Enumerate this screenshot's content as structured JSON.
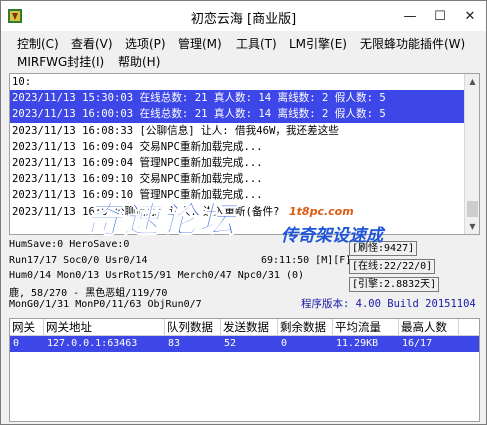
{
  "window": {
    "title": "初恋云海 [商业版]",
    "minimize_glyph": "—",
    "maximize_glyph": "☐",
    "close_glyph": "✕"
  },
  "menu": {
    "items": [
      {
        "label": "控制(C)"
      },
      {
        "label": "查看(V)"
      },
      {
        "label": "选项(P)"
      },
      {
        "label": "管理(M)"
      },
      {
        "label": "工具(T)"
      },
      {
        "label": "LM引擎(E)"
      },
      {
        "label": "无限蜂功能插件(W)"
      },
      {
        "label": "MIRFWG封挂(I)"
      },
      {
        "label": "帮助(H)"
      }
    ]
  },
  "log": {
    "lines": [
      {
        "text": "10:"
      },
      {
        "text": "2023/11/13 15:30:03 在线总数: 21 真人数: 14 离线数: 2 假人数: 5"
      },
      {
        "text": "2023/11/13 16:00:03 在线总数: 21 真人数: 14 离线数: 2 假人数: 5"
      },
      {
        "text": "2023/11/13 16:08:33 [公聊信息] 让人: 借我46W，我还差这些"
      },
      {
        "text": "2023/11/13 16:09:04 交易NPC重新加载完成..."
      },
      {
        "text": "2023/11/13 16:09:04 管理NPC重新加载完成..."
      },
      {
        "text": "2023/11/13 16:09:10 交易NPC重新加载完成..."
      },
      {
        "text": "2023/11/13 16:09:10 管理NPC重新加载完成..."
      },
      {
        "text": "2023/11/13 16:0   公聊信息] 让人: 进入重新(备件?"
      }
    ],
    "selected": [
      1,
      2
    ],
    "scroll_up_glyph": "▲",
    "scroll_down_glyph": "▼"
  },
  "watermark": {
    "main": "奇速论坛",
    "site": "1t8pc.com",
    "sub": "传奇架设速成"
  },
  "stats": {
    "humsave": "HumSave:0 HeroSave:0",
    "run": "Run17/17 Soc0/0 Usr0/14",
    "clock": "69:11:50 [M][F]",
    "hum": "Hum0/14 Mon0/13 UsrRot15/91 Merch0/47 Npc0/31 (0)",
    "deer": "鹿, 58/270 - 黑色恶蛆/119/70",
    "mong": "MonG0/1/31 MonP0/11/63 ObjRun0/7",
    "refresh": "[刷怪:9427]",
    "online": "[在线:22/22/0]",
    "engine": "[引擎:2.8832天]",
    "version": "程序版本: 4.00 Build 20151104"
  },
  "gateway_table": {
    "columns": [
      "网关",
      "网关地址",
      "队列数据",
      "发送数据",
      "剩余数据",
      "平均流量",
      "最高人数"
    ],
    "rows": [
      [
        "0",
        "127.0.0.1:63463",
        "83",
        "52",
        "0",
        "11.29KB",
        "16/17"
      ]
    ]
  },
  "colors": {
    "selection": "#3d46e6",
    "watermark_blue": "#1f55d6",
    "watermark_orange": "#e05a10",
    "version_text": "#1a1aa6"
  },
  "icons": {
    "app": "app-icon"
  }
}
